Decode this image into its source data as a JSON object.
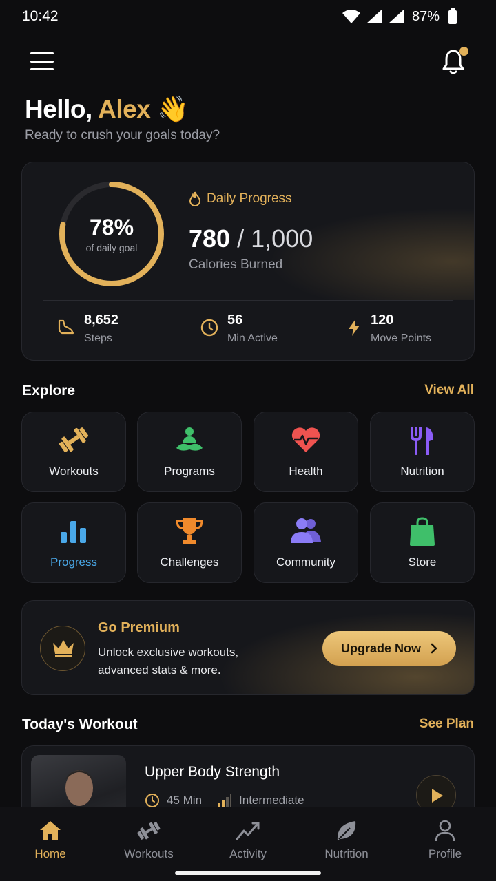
{
  "status_bar": {
    "time": "10:42",
    "battery_pct": "87%"
  },
  "greeting": {
    "hello": "Hello,",
    "name": "Alex",
    "emoji": "👋",
    "subtitle": "Ready to crush your goals today?"
  },
  "daily_progress": {
    "percent_text": "78%",
    "percent_value": 0.78,
    "percent_caption": "of daily goal",
    "label": "Daily Progress",
    "calories_current": "780",
    "calories_separator": "/",
    "calories_goal": "1,000",
    "calories_label": "Calories Burned",
    "stats": [
      {
        "value": "8,652",
        "label": "Steps",
        "icon": "shoe-icon"
      },
      {
        "value": "56",
        "label": "Min Active",
        "icon": "clock-icon"
      },
      {
        "value": "120",
        "label": "Move Points",
        "icon": "bolt-icon"
      }
    ]
  },
  "explore": {
    "title": "Explore",
    "view_all": "View All",
    "tiles": [
      {
        "label": "Workouts",
        "icon": "dumbbell-icon",
        "color": "#e2b15a"
      },
      {
        "label": "Programs",
        "icon": "meditation-icon",
        "color": "#3fbf6a"
      },
      {
        "label": "Health",
        "icon": "heart-pulse-icon",
        "color": "#ef5350"
      },
      {
        "label": "Nutrition",
        "icon": "fork-knife-icon",
        "color": "#8b5cf6"
      },
      {
        "label": "Progress",
        "icon": "bar-chart-icon",
        "color": "#4aa8e8"
      },
      {
        "label": "Challenges",
        "icon": "trophy-icon",
        "color": "#f08a2c"
      },
      {
        "label": "Community",
        "icon": "people-icon",
        "color": "#8b7cf6"
      },
      {
        "label": "Store",
        "icon": "shopping-bag-icon",
        "color": "#3fbf6a"
      }
    ]
  },
  "premium": {
    "title": "Go Premium",
    "description": "Unlock exclusive workouts, advanced stats & more.",
    "button": "Upgrade Now"
  },
  "todays_workout": {
    "title": "Today's Workout",
    "see_plan": "See Plan",
    "workout_name": "Upper Body Strength",
    "duration": "45 Min",
    "level": "Intermediate"
  },
  "bottom_nav": [
    {
      "label": "Home",
      "icon": "home-icon"
    },
    {
      "label": "Workouts",
      "icon": "dumbbell-icon"
    },
    {
      "label": "Activity",
      "icon": "activity-icon"
    },
    {
      "label": "Nutrition",
      "icon": "leaf-icon"
    },
    {
      "label": "Profile",
      "icon": "person-icon"
    }
  ],
  "colors": {
    "accent": "#e2b15a",
    "background": "#0d0d0f",
    "card": "#16171b"
  }
}
